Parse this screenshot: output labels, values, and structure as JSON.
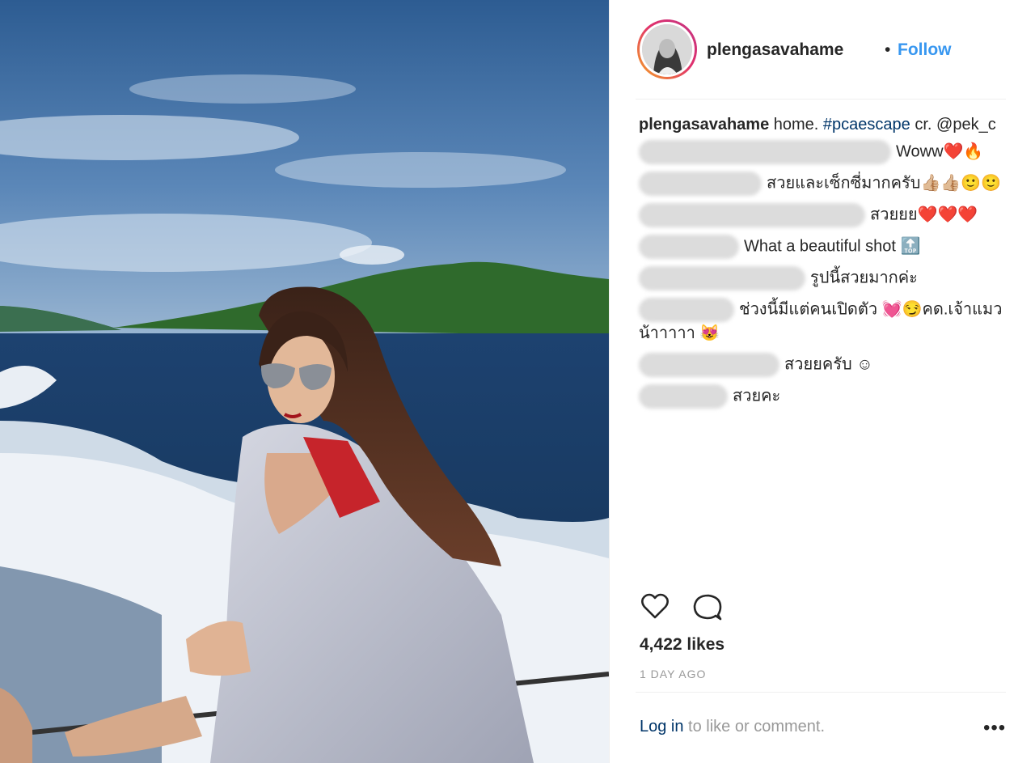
{
  "header": {
    "username": "plengasavahame",
    "separator": "•",
    "follow_label": "Follow"
  },
  "caption": {
    "username": "plengasavahame",
    "text_before": "home. ",
    "hashtag": "#pcaescape",
    "text_after": " cr. @pek_c"
  },
  "comments": [
    {
      "text": "Woww❤️🔥"
    },
    {
      "text": "สวยและเซ็กซี่มากครับ👍🏼👍🏼🙂🙂"
    },
    {
      "text": "สวยยย❤️❤️❤️"
    },
    {
      "text": "What a beautiful shot 🔝"
    },
    {
      "text": "รูปนี้สวยมากค่ะ"
    },
    {
      "text": "ช่วงนี้มีแต่คนเปิดตัว 💓😏คด.เจ้าแมวน้าาาาา 😻"
    },
    {
      "text": "สวยยครับ ☺"
    },
    {
      "text": "สวยคะ"
    }
  ],
  "actions": {
    "like_icon": "heart-icon",
    "comment_icon": "comment-icon"
  },
  "likes": "4,422 likes",
  "timestamp": "1 DAY AGO",
  "footer": {
    "login_label": "Log in",
    "prompt": " to like or comment.",
    "more_label": "•••"
  },
  "colors": {
    "link_blue": "#3897f0",
    "text": "#262626",
    "muted": "#999999",
    "hashtag": "#003569"
  }
}
